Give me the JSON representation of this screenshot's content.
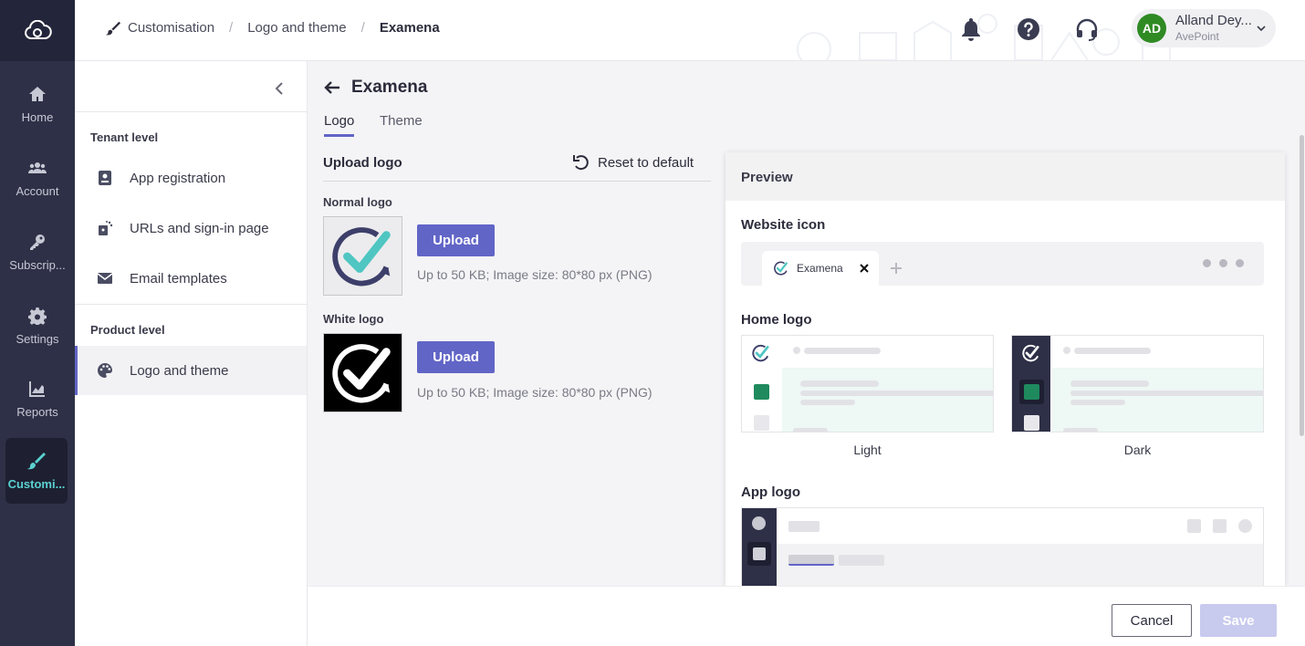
{
  "rail": {
    "items": [
      {
        "label": "Home",
        "icon": "home-icon"
      },
      {
        "label": "Account",
        "icon": "users-icon"
      },
      {
        "label": "Subscrip...",
        "icon": "key-icon"
      },
      {
        "label": "Settings",
        "icon": "gear-icon"
      },
      {
        "label": "Reports",
        "icon": "chart-icon"
      },
      {
        "label": "Customi...",
        "icon": "brush-icon"
      }
    ]
  },
  "breadcrumb": {
    "items": [
      "Customisation",
      "Logo and theme",
      "Examena"
    ]
  },
  "user": {
    "initials": "AD",
    "name": "Alland Dey...",
    "org": "AvePoint"
  },
  "sidebar": {
    "tenant_section": "Tenant level",
    "tenant_items": [
      "App registration",
      "URLs and sign-in page",
      "Email templates"
    ],
    "product_section": "Product level",
    "product_items": [
      "Logo and theme"
    ]
  },
  "main": {
    "title": "Examena",
    "tabs": [
      "Logo",
      "Theme"
    ],
    "upload_heading": "Upload logo",
    "reset_label": "Reset to default",
    "normal_logo_label": "Normal logo",
    "white_logo_label": "White logo",
    "upload_label": "Upload",
    "upload_hint": "Up to 50 KB; Image size: 80*80 px (PNG)"
  },
  "preview": {
    "title": "Preview",
    "website_icon_label": "Website icon",
    "browser_tab_name": "Examena",
    "home_logo_label": "Home logo",
    "light_label": "Light",
    "dark_label": "Dark",
    "app_logo_label": "App logo"
  },
  "footer": {
    "cancel_label": "Cancel",
    "save_label": "Save"
  },
  "colors": {
    "accent": "#6165c6",
    "teal": "#4fc6c2",
    "rail": "#2e3047",
    "green": "#1f8a5e"
  }
}
